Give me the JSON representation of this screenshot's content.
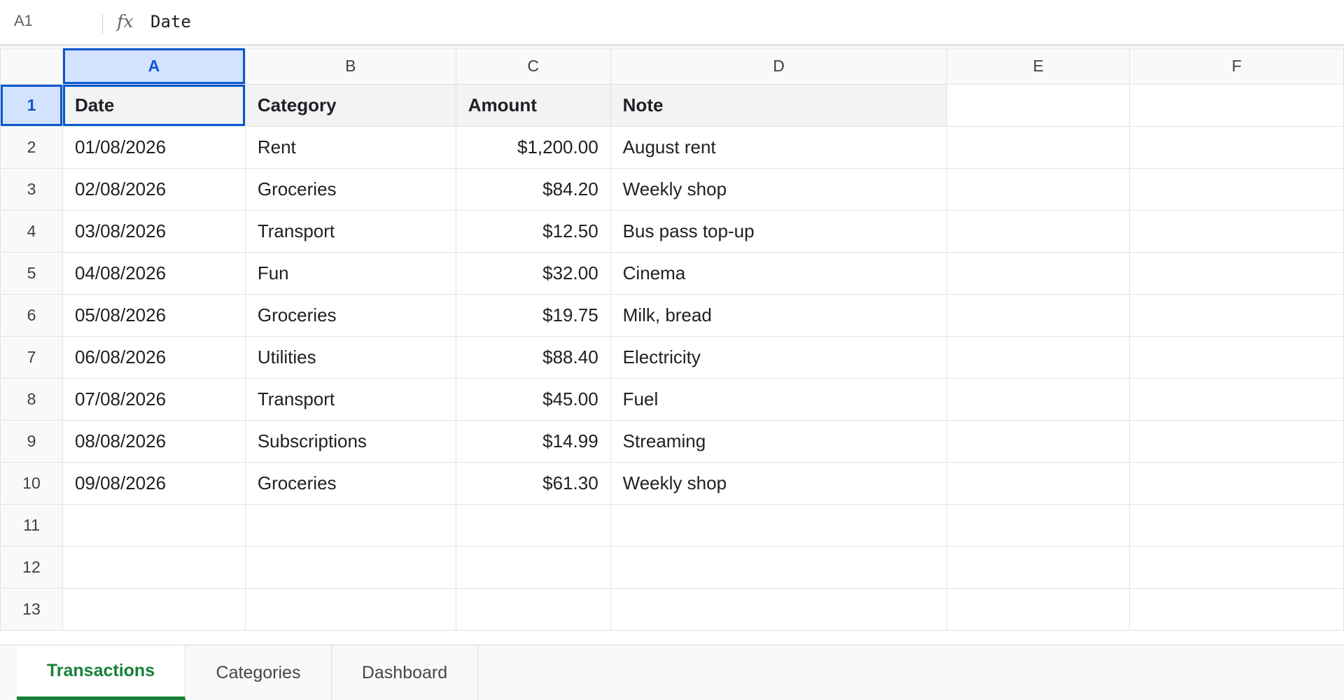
{
  "formula_bar": {
    "cell_ref": "A1",
    "fx_symbol": "fx",
    "formula_value": "Date"
  },
  "grid": {
    "columns": [
      "A",
      "B",
      "C",
      "D",
      "E",
      "F"
    ],
    "selected_column": "A",
    "selected_row": "1",
    "rows": [
      {
        "num": "1",
        "cells": [
          "Date",
          "Category",
          "Amount",
          "Note",
          "",
          ""
        ]
      },
      {
        "num": "2",
        "cells": [
          "01/08/2026",
          "Rent",
          "$1,200.00",
          "August rent",
          "",
          ""
        ]
      },
      {
        "num": "3",
        "cells": [
          "02/08/2026",
          "Groceries",
          "$84.20",
          "Weekly shop",
          "",
          ""
        ]
      },
      {
        "num": "4",
        "cells": [
          "03/08/2026",
          "Transport",
          "$12.50",
          "Bus pass top-up",
          "",
          ""
        ]
      },
      {
        "num": "5",
        "cells": [
          "04/08/2026",
          "Fun",
          "$32.00",
          "Cinema",
          "",
          ""
        ]
      },
      {
        "num": "6",
        "cells": [
          "05/08/2026",
          "Groceries",
          "$19.75",
          "Milk, bread",
          "",
          ""
        ]
      },
      {
        "num": "7",
        "cells": [
          "06/08/2026",
          "Utilities",
          "$88.40",
          "Electricity",
          "",
          ""
        ]
      },
      {
        "num": "8",
        "cells": [
          "07/08/2026",
          "Transport",
          "$45.00",
          "Fuel",
          "",
          ""
        ]
      },
      {
        "num": "9",
        "cells": [
          "08/08/2026",
          "Subscriptions",
          "$14.99",
          "Streaming",
          "",
          ""
        ]
      },
      {
        "num": "10",
        "cells": [
          "09/08/2026",
          "Groceries",
          "$61.30",
          "Weekly shop",
          "",
          ""
        ]
      },
      {
        "num": "11",
        "cells": [
          "",
          "",
          "",
          "",
          "",
          ""
        ]
      },
      {
        "num": "12",
        "cells": [
          "",
          "",
          "",
          "",
          "",
          ""
        ]
      },
      {
        "num": "13",
        "cells": [
          "",
          "",
          "",
          "",
          "",
          ""
        ]
      }
    ]
  },
  "sheet_tabs": [
    {
      "label": "Transactions",
      "active": true
    },
    {
      "label": "Categories",
      "active": false
    },
    {
      "label": "Dashboard",
      "active": false
    }
  ],
  "colors": {
    "selection": "#0b57d0",
    "selection_fill": "#d3e3fd",
    "active_tab": "#188038"
  }
}
